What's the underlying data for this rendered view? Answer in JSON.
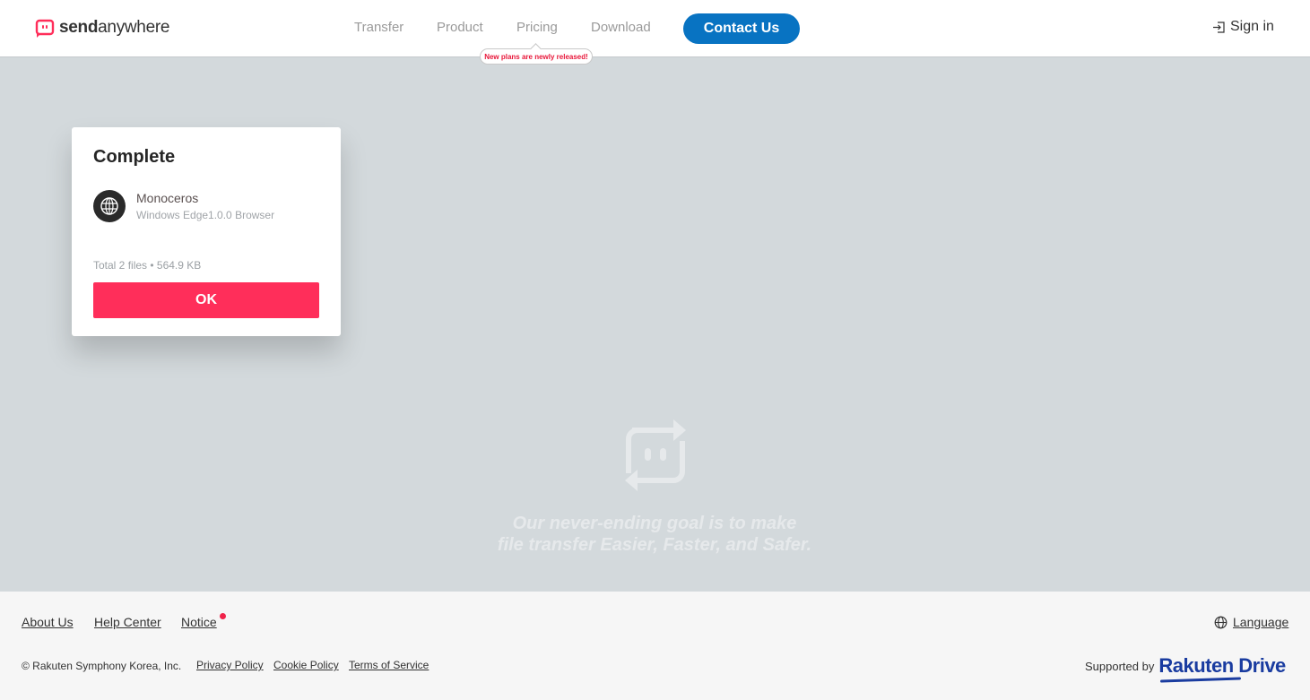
{
  "header": {
    "logo": {
      "brand_bold": "send",
      "brand_light": "anywhere",
      "brand_color": "#ff2e5a"
    },
    "nav": [
      {
        "label": "Transfer"
      },
      {
        "label": "Product"
      },
      {
        "label": "Pricing"
      },
      {
        "label": "Download"
      }
    ],
    "contact_label": "Contact Us",
    "pricing_tooltip": "New plans are newly released!",
    "signin_label": "Sign in",
    "accent_color": "#0873c2"
  },
  "dialog": {
    "title": "Complete",
    "device_name": "Monoceros",
    "device_detail": "Windows Edge1.0.0 Browser",
    "device_icon": "globe-icon",
    "summary": "Total 2 files • 564.9 KB",
    "ok_label": "OK",
    "ok_color": "#ff2e5a"
  },
  "hero": {
    "tagline_line1": "Our never-ending goal is to make",
    "tagline_line2": "file transfer Easier, Faster, and Safer."
  },
  "footer": {
    "links": [
      {
        "label": "About Us"
      },
      {
        "label": "Help Center"
      },
      {
        "label": "Notice"
      }
    ],
    "language_label": "Language",
    "copyright": "© Rakuten Symphony Korea, Inc.",
    "legal": [
      {
        "label": "Privacy Policy"
      },
      {
        "label": "Cookie Policy"
      },
      {
        "label": "Terms of Service"
      }
    ],
    "supported_by": "Supported by",
    "partner": "Rakuten Drive"
  }
}
